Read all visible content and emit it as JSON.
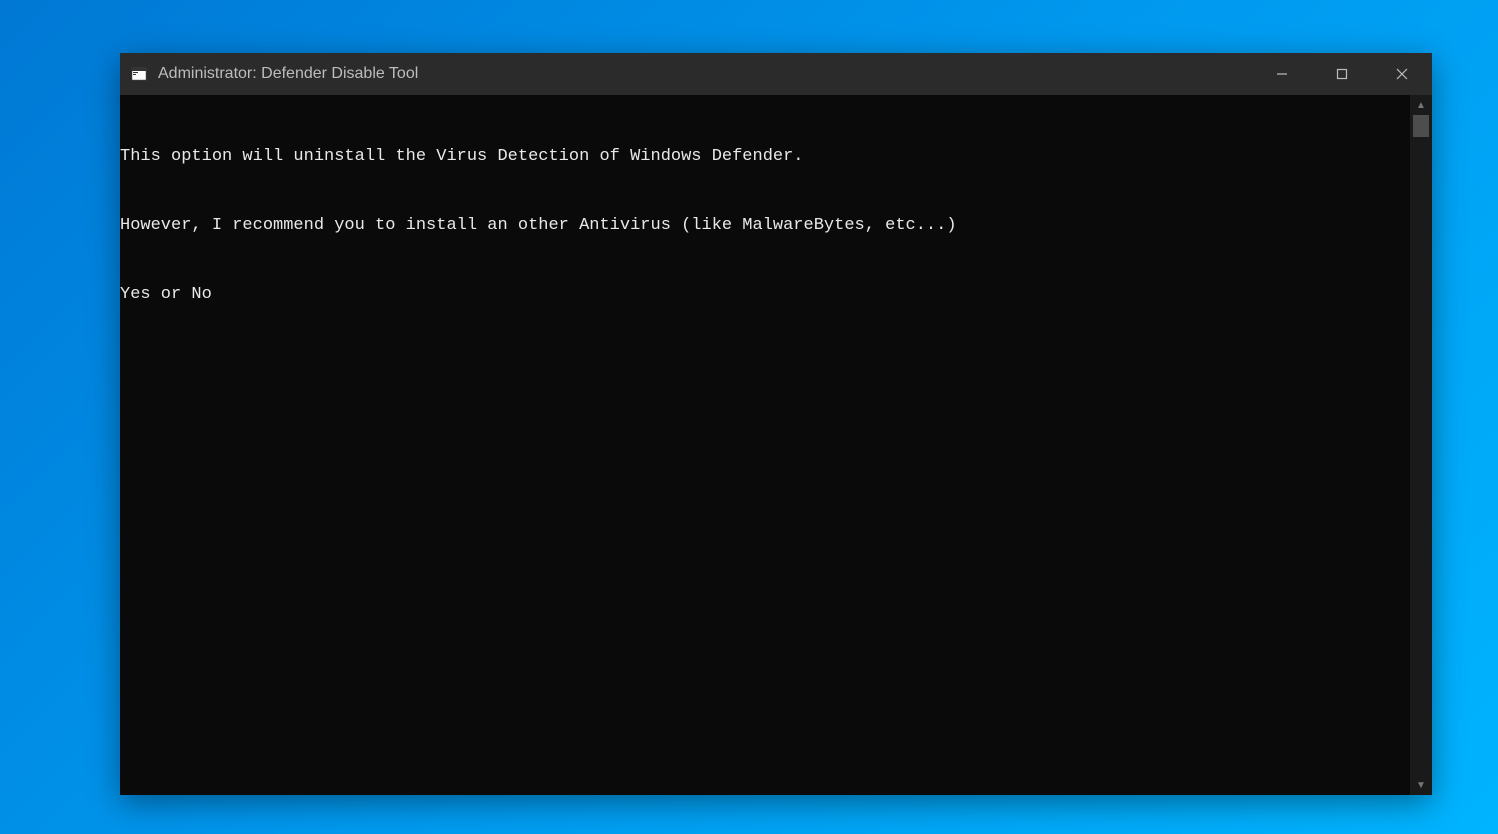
{
  "window": {
    "title": "Administrator:  Defender Disable Tool"
  },
  "terminal": {
    "lines": [
      "This option will uninstall the Virus Detection of Windows Defender.",
      "However, I recommend you to install an other Antivirus (like MalwareBytes, etc...)",
      "Yes or No"
    ]
  }
}
